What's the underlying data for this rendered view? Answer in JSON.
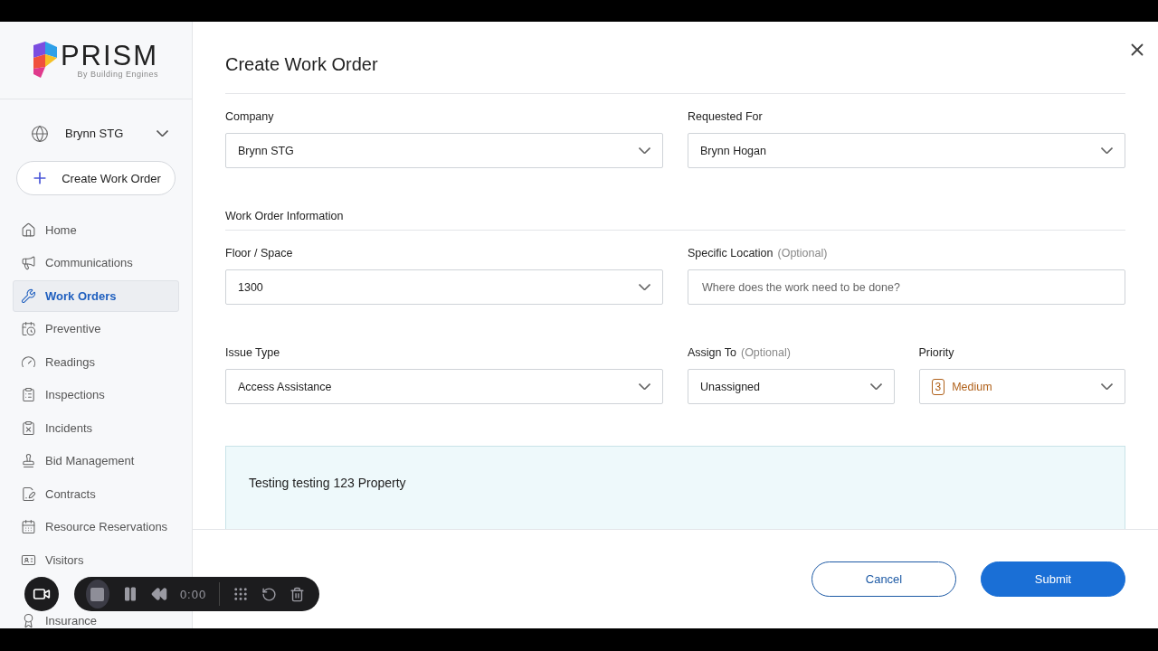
{
  "sidebar": {
    "logo": {
      "name": "PRISM",
      "tagline": "By Building Engines"
    },
    "scope": {
      "label": "Brynn STG"
    },
    "create_button": {
      "label": "Create Work Order"
    },
    "items": [
      {
        "label": "Home",
        "selected": false
      },
      {
        "label": "Communications",
        "selected": false
      },
      {
        "label": "Work Orders",
        "selected": true
      },
      {
        "label": "Preventive",
        "selected": false
      },
      {
        "label": "Readings",
        "selected": false
      },
      {
        "label": "Inspections",
        "selected": false
      },
      {
        "label": "Incidents",
        "selected": false
      },
      {
        "label": "Bid Management",
        "selected": false
      },
      {
        "label": "Contracts",
        "selected": false
      },
      {
        "label": "Resource Reservations",
        "selected": false
      },
      {
        "label": "Visitors",
        "selected": false
      },
      {
        "label": "Insurance",
        "selected": false
      }
    ]
  },
  "dialog": {
    "title": "Create Work Order",
    "rows": [
      {
        "fields": [
          {
            "kind": "select",
            "label": "Company",
            "value": "Brynn STG"
          },
          {
            "kind": "select",
            "label": "Requested For",
            "value": "Brynn Hogan"
          }
        ]
      },
      {
        "section": "Work Order Information"
      },
      {
        "fields": [
          {
            "kind": "select",
            "label": "Floor / Space",
            "value": "1300"
          },
          {
            "kind": "input",
            "label": "Specific Location",
            "note": "(Optional)",
            "placeholder": "Where does the work need to be done?"
          }
        ]
      },
      {
        "fields": [
          {
            "kind": "select",
            "label": "Issue Type",
            "value": "Access Assistance"
          },
          {
            "kind": "select",
            "label": "Assign To",
            "note": "(Optional)",
            "value": "Unassigned"
          },
          {
            "kind": "priority",
            "label": "Priority",
            "badge": "3",
            "value": "Medium"
          }
        ]
      }
    ],
    "info_box": "Testing testing 123 Property",
    "buttons": [
      {
        "label": "Cancel",
        "kind": "secondary"
      },
      {
        "label": "Submit",
        "kind": "primary"
      }
    ]
  },
  "recorder": {
    "time": "0:00"
  }
}
